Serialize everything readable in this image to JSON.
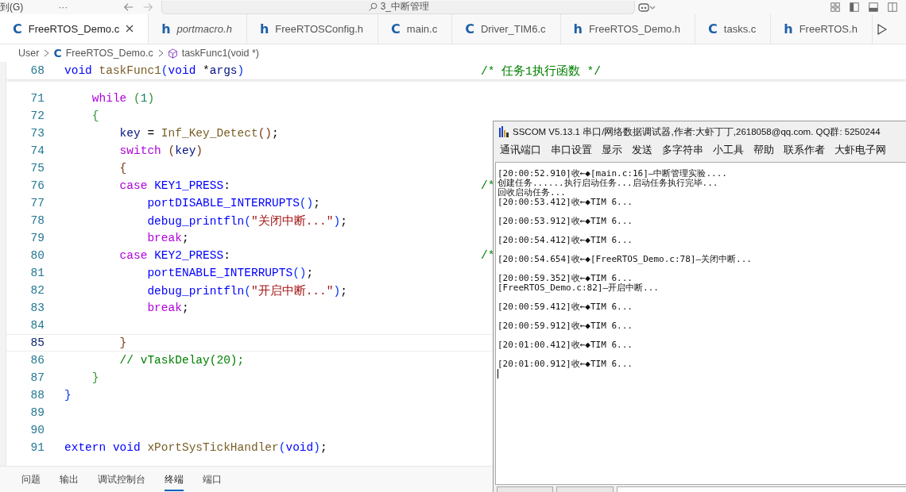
{
  "top_bar": {
    "menu_label": "到(G)",
    "more": "···",
    "search": {
      "value": "3_中断管理"
    }
  },
  "tabs": [
    {
      "icon": "C",
      "label": "FreeRTOS_Demo.c",
      "selected": true,
      "preview": false
    },
    {
      "icon": "h",
      "label": "portmacro.h",
      "selected": false,
      "preview": true
    },
    {
      "icon": "h",
      "label": "FreeRTOSConfig.h",
      "selected": false,
      "preview": false
    },
    {
      "icon": "C",
      "label": "main.c",
      "selected": false,
      "preview": false
    },
    {
      "icon": "C",
      "label": "Driver_TIM6.c",
      "selected": false,
      "preview": false
    },
    {
      "icon": "h",
      "label": "FreeRTOS_Demo.h",
      "selected": false,
      "preview": false
    },
    {
      "icon": "C",
      "label": "tasks.c",
      "selected": false,
      "preview": false
    },
    {
      "icon": "h",
      "label": "FreeRTOS.h",
      "selected": false,
      "preview": false
    }
  ],
  "breadcrumb": {
    "folder": "User",
    "file_icon": "C",
    "file": "FreeRTOS_Demo.c",
    "symbol": "taskFunc1(void *)"
  },
  "editor": {
    "sticky_line": {
      "number": "68",
      "tokens": [
        {
          "text": "void ",
          "kind": "kw"
        },
        {
          "text": "taskFunc1",
          "kind": "fn"
        },
        {
          "text": "(",
          "kind": "b1"
        },
        {
          "text": "void ",
          "kind": "kw"
        },
        {
          "text": "*",
          "kind": "plain"
        },
        {
          "text": "args",
          "kind": "var"
        },
        {
          "text": ")",
          "kind": "b1"
        }
      ],
      "note": "/* 任务1执行函数 */"
    },
    "lines": [
      {
        "number": "71",
        "current": false,
        "tokens": [
          {
            "text": "    while ",
            "kind": "ctrl"
          },
          {
            "text": "(",
            "kind": "b2"
          },
          {
            "text": "1",
            "kind": "num"
          },
          {
            "text": ")",
            "kind": "b2"
          }
        ]
      },
      {
        "number": "72",
        "current": false,
        "tokens": [
          {
            "text": "    {",
            "kind": "b2"
          }
        ]
      },
      {
        "number": "73",
        "current": false,
        "tokens": [
          {
            "text": "        key",
            "kind": "var"
          },
          {
            "text": " = ",
            "kind": "plain"
          },
          {
            "text": "Inf_Key_Detect",
            "kind": "fn"
          },
          {
            "text": "()",
            "kind": "b3"
          },
          {
            "text": ";",
            "kind": "plain"
          }
        ]
      },
      {
        "number": "74",
        "current": false,
        "tokens": [
          {
            "text": "        switch ",
            "kind": "ctrl"
          },
          {
            "text": "(",
            "kind": "b3"
          },
          {
            "text": "key",
            "kind": "var"
          },
          {
            "text": ")",
            "kind": "b3"
          }
        ]
      },
      {
        "number": "75",
        "current": false,
        "tokens": [
          {
            "text": "        {",
            "kind": "b3"
          }
        ]
      },
      {
        "number": "76",
        "current": false,
        "tokens": [
          {
            "text": "        case ",
            "kind": "ctrl"
          },
          {
            "text": "KEY1_PRESS",
            "kind": "macro"
          },
          {
            "text": ":",
            "kind": "plain"
          }
        ],
        "note": "/*"
      },
      {
        "number": "77",
        "current": false,
        "tokens": [
          {
            "text": "            portDISABLE_INTERRUPTS",
            "kind": "macro"
          },
          {
            "text": "()",
            "kind": "b1"
          },
          {
            "text": ";",
            "kind": "plain"
          }
        ]
      },
      {
        "number": "78",
        "current": false,
        "tokens": [
          {
            "text": "            debug_printfln",
            "kind": "macro"
          },
          {
            "text": "(",
            "kind": "b1"
          },
          {
            "text": "\"关闭中断...\"",
            "kind": "str"
          },
          {
            "text": ")",
            "kind": "b1"
          },
          {
            "text": ";",
            "kind": "plain"
          }
        ]
      },
      {
        "number": "79",
        "current": false,
        "tokens": [
          {
            "text": "            break",
            "kind": "ctrl"
          },
          {
            "text": ";",
            "kind": "plain"
          }
        ]
      },
      {
        "number": "80",
        "current": false,
        "tokens": [
          {
            "text": "        case ",
            "kind": "ctrl"
          },
          {
            "text": "KEY2_PRESS",
            "kind": "macro"
          },
          {
            "text": ":",
            "kind": "plain"
          }
        ],
        "note": "/*"
      },
      {
        "number": "81",
        "current": false,
        "tokens": [
          {
            "text": "            portENABLE_INTERRUPTS",
            "kind": "macro"
          },
          {
            "text": "()",
            "kind": "b1"
          },
          {
            "text": ";",
            "kind": "plain"
          }
        ]
      },
      {
        "number": "82",
        "current": false,
        "tokens": [
          {
            "text": "            debug_printfln",
            "kind": "macro"
          },
          {
            "text": "(",
            "kind": "b1"
          },
          {
            "text": "\"开启中断...\"",
            "kind": "str"
          },
          {
            "text": ")",
            "kind": "b1"
          },
          {
            "text": ";",
            "kind": "plain"
          }
        ]
      },
      {
        "number": "83",
        "current": false,
        "tokens": [
          {
            "text": "            break",
            "kind": "ctrl"
          },
          {
            "text": ";",
            "kind": "plain"
          }
        ]
      },
      {
        "number": "84",
        "current": false
      },
      {
        "number": "85",
        "current": true,
        "tokens": [
          {
            "text": "        }",
            "kind": "b3"
          }
        ]
      },
      {
        "number": "86",
        "current": false,
        "tokens": [
          {
            "text": "        // vTaskDelay(20);",
            "kind": "comment"
          }
        ]
      },
      {
        "number": "87",
        "current": false,
        "tokens": [
          {
            "text": "    }",
            "kind": "b2"
          }
        ]
      },
      {
        "number": "88",
        "current": false,
        "tokens": [
          {
            "text": "}",
            "kind": "b1"
          }
        ]
      },
      {
        "number": "89",
        "current": false
      },
      {
        "number": "90",
        "current": false
      },
      {
        "number": "91",
        "current": false,
        "tokens": [
          {
            "text": "extern void ",
            "kind": "kw"
          },
          {
            "text": "xPortSysTickHandler",
            "kind": "fn"
          },
          {
            "text": "(",
            "kind": "b1"
          },
          {
            "text": "void",
            "kind": "kw"
          },
          {
            "text": ")",
            "kind": "b1"
          },
          {
            "text": ";",
            "kind": "plain"
          }
        ]
      }
    ]
  },
  "panel": {
    "tabs": [
      {
        "label": "问题",
        "selected": false
      },
      {
        "label": "输出",
        "selected": false
      },
      {
        "label": "调试控制台",
        "selected": false
      },
      {
        "label": "终端",
        "selected": true
      },
      {
        "label": "端口",
        "selected": false
      }
    ]
  },
  "sscom": {
    "title": "SSCOM V5.13.1 串口/网络数据调试器,作者:大虾丁丁,2618058@qq.com. QQ群: 5250244",
    "menu": [
      "通讯端口",
      "串口设置",
      "显示",
      "发送",
      "多字符串",
      "小工具",
      "帮助",
      "联系作者",
      "大虾电子网"
    ],
    "log": [
      {
        "text": "[20:00:52.910]收←◆[main.c:16]—中断管理实验....",
        "gap_before": false
      },
      {
        "text": "创建任务......执行启动任务...启动任务执行完毕...",
        "gap_before": false
      },
      {
        "text": "回收启动任务...",
        "gap_before": false
      },
      {
        "text": "[20:00:53.412]收←◆TIM 6...",
        "gap_before": false
      },
      {
        "text": "[20:00:53.912]收←◆TIM 6...",
        "gap_before": true
      },
      {
        "text": "[20:00:54.412]收←◆TIM 6...",
        "gap_before": true
      },
      {
        "text": "[20:00:54.654]收←◆[FreeRTOS_Demo.c:78]—关闭中断...",
        "gap_before": true
      },
      {
        "text": "[20:00:59.352]收←◆TIM 6...",
        "gap_before": true
      },
      {
        "text": "[FreeRTOS_Demo.c:82]—开启中断...",
        "gap_before": false
      },
      {
        "text": "[20:00:59.412]收←◆TIM 6...",
        "gap_before": true
      },
      {
        "text": "[20:00:59.912]收←◆TIM 6...",
        "gap_before": true
      },
      {
        "text": "[20:01:00.412]收←◆TIM 6...",
        "gap_before": true
      },
      {
        "text": "[20:01:00.912]收←◆TIM 6...",
        "gap_before": true
      }
    ]
  }
}
